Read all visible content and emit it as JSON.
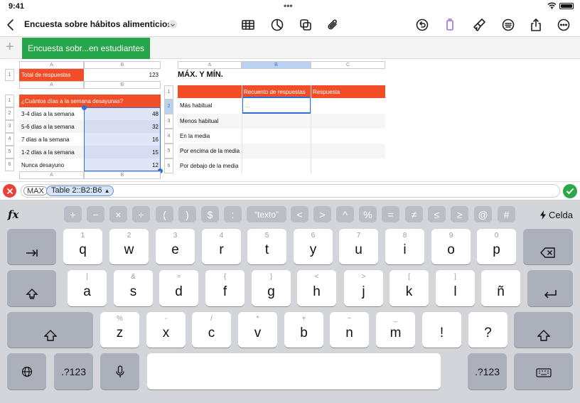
{
  "status": {
    "time": "9:41"
  },
  "toolbar": {
    "doc_title": "Encuesta sobre hábitos alimenticios"
  },
  "sheet_tab": {
    "label": "Encuesta sobr...en estudiantes"
  },
  "table_total": {
    "cols": [
      "A",
      "B"
    ],
    "row_num": "1",
    "label": "Total de respuestas",
    "value": "123"
  },
  "table_q": {
    "cols": [
      "A",
      "B"
    ],
    "header": "¿Cuántos días a la semana desayunas?",
    "rows": [
      {
        "num": "1"
      },
      {
        "num": "2",
        "label": "3-4 días a la semana",
        "value": "48"
      },
      {
        "num": "3",
        "label": "5-6 días a la semana",
        "value": "32"
      },
      {
        "num": "4",
        "label": "7 días a la semana",
        "value": "16"
      },
      {
        "num": "5",
        "label": "1-2 días a la semana",
        "value": "15"
      },
      {
        "num": "6",
        "label": "Nunca desayuno",
        "value": "12"
      }
    ],
    "footer_cols": [
      "A",
      "B"
    ]
  },
  "table_mm": {
    "title": "MÁX. Y MÍN.",
    "cols": [
      "A",
      "B",
      "C"
    ],
    "headers": [
      "Recuento de respuestas",
      "Respuesta"
    ],
    "rows": [
      {
        "num": "1"
      },
      {
        "num": "2",
        "label": "Más habitual",
        "value": "..."
      },
      {
        "num": "3",
        "label": "Menos habitual"
      },
      {
        "num": "4",
        "label": "En la media"
      },
      {
        "num": "5",
        "label": "Por encima de la media"
      },
      {
        "num": "6",
        "label": "Por debajo de la media"
      }
    ]
  },
  "formula": {
    "fn": "MAX",
    "ref": "Table 2::B2:B6"
  },
  "keyboard": {
    "fx": "fx",
    "fkeys": [
      "+",
      "−",
      "×",
      "÷",
      "(",
      ")",
      "$",
      ":",
      "“texto”",
      "<",
      ">",
      "^",
      "%",
      "=",
      "≠",
      "≤",
      "≥",
      "@",
      "#"
    ],
    "cell_label": "Celda",
    "row1": [
      {
        "hint": "1",
        "key": "q"
      },
      {
        "hint": "2",
        "key": "w"
      },
      {
        "hint": "3",
        "key": "e"
      },
      {
        "hint": "4",
        "key": "r"
      },
      {
        "hint": "5",
        "key": "t"
      },
      {
        "hint": "6",
        "key": "y"
      },
      {
        "hint": "7",
        "key": "u"
      },
      {
        "hint": "8",
        "key": "i"
      },
      {
        "hint": "9",
        "key": "o"
      },
      {
        "hint": "0",
        "key": "p"
      }
    ],
    "row2": [
      {
        "hint": "|",
        "key": "a"
      },
      {
        "hint": "&",
        "key": "s"
      },
      {
        "hint": "=",
        "key": "d"
      },
      {
        "hint": "{",
        "key": "f"
      },
      {
        "hint": "}",
        "key": "g"
      },
      {
        "hint": "<",
        "key": "h"
      },
      {
        "hint": ">",
        "key": "j"
      },
      {
        "hint": "[",
        "key": "k"
      },
      {
        "hint": "]",
        "key": "l"
      },
      {
        "hint": "",
        "key": "ñ"
      }
    ],
    "row3": [
      {
        "hint": "%",
        "key": "z"
      },
      {
        "hint": "-",
        "key": "x"
      },
      {
        "hint": "/",
        "key": "c"
      },
      {
        "hint": "*",
        "key": "v"
      },
      {
        "hint": "+",
        "key": "b"
      },
      {
        "hint": "~",
        "key": "n"
      },
      {
        "hint": "_",
        "key": "m"
      },
      {
        "hint": "",
        "key": "!"
      },
      {
        "hint": "",
        "key": "?"
      }
    ],
    "numbers_label": ".?123"
  }
}
